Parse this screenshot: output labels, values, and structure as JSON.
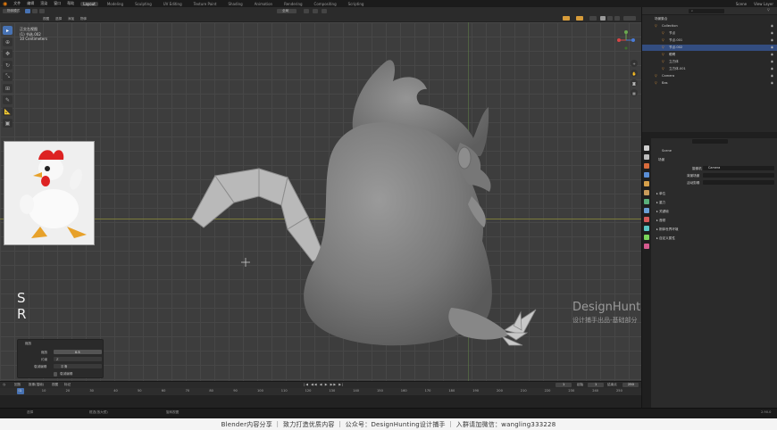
{
  "topbar": {
    "menus": [
      "文件",
      "编辑",
      "渲染",
      "窗口",
      "帮助"
    ],
    "workspaces": [
      "Layout",
      "Modeling",
      "Sculpting",
      "UV Editing",
      "Texture Paint",
      "Shading",
      "Animation",
      "Rendering",
      "Compositing",
      "Scripting"
    ],
    "active_workspace": "Layout",
    "scene": "Scene",
    "view_layer": "View Layer"
  },
  "viewport_header": {
    "mode": "物体模式",
    "menus": [
      "视图",
      "选择",
      "添加",
      "物体"
    ],
    "orientation": "全局"
  },
  "viewport_info": {
    "line1": "正交左视图",
    "line2": "(1) 节选.002",
    "line3": "10 Centimeters"
  },
  "overlay": {
    "sr_line1": "S",
    "sr_line2": "R"
  },
  "watermark": {
    "title": "DesignHunting",
    "subtitle": "设计捕手出品-基础部分"
  },
  "operator_panel": {
    "title": "缩放",
    "row1_label": "缩放",
    "row1_value": "0.5",
    "row2_label": "约束",
    "row2_value": "Z",
    "row3_label": "衰减编辑",
    "row3_value": "平滑",
    "checkbox_label": "衰减编辑"
  },
  "outliner": {
    "root": "场景集合",
    "items": [
      {
        "name": "Collection",
        "indent": 1,
        "selected": false
      },
      {
        "name": "节点",
        "indent": 2,
        "selected": false
      },
      {
        "name": "节点.001",
        "indent": 2,
        "selected": false
      },
      {
        "name": "节点.002",
        "indent": 2,
        "selected": true
      },
      {
        "name": "眼睛",
        "indent": 2,
        "selected": false
      },
      {
        "name": "立方体",
        "indent": 2,
        "selected": false
      },
      {
        "name": "立方体.001",
        "indent": 2,
        "selected": false
      },
      {
        "name": "Camera",
        "indent": 1,
        "selected": false
      },
      {
        "name": "Bas",
        "indent": 1,
        "selected": false
      }
    ]
  },
  "properties": {
    "tab_colors": [
      "#cfcfcf",
      "#bdbdbd",
      "#d96b3c",
      "#5a8ed6",
      "#d6a04a",
      "#c99b5a",
      "#5ab07a",
      "#6a9fd6",
      "#d65a5a",
      "#5ac5c5",
      "#7ad65a",
      "#d65a8e"
    ],
    "scene_name": "Scene",
    "section_scene": "场景",
    "camera_label": "摄像机",
    "camera_value": "Camera",
    "bg_scene_label": "背景场景",
    "active_clip_label": "活动剪辑",
    "sections": [
      "单位",
      "重力",
      "关键帧",
      "音频",
      "刚体世界环境",
      "自定义属性"
    ]
  },
  "timeline": {
    "menus": [
      "回放",
      "抠像(插帧)",
      "视图",
      "标记"
    ],
    "current_frame": "1",
    "start_label": "起始",
    "start": "1",
    "end_label": "结束点",
    "end": "250",
    "ticks": [
      "0",
      "10",
      "20",
      "30",
      "40",
      "50",
      "60",
      "70",
      "80",
      "90",
      "100",
      "110",
      "120",
      "130",
      "140",
      "150",
      "160",
      "170",
      "180",
      "190",
      "200",
      "210",
      "220",
      "230",
      "240",
      "250"
    ]
  },
  "statusbar": {
    "item1": "选择",
    "item2": "框选(放大镜)",
    "item3": "旋转视图",
    "version": "2.90.0"
  },
  "caption": "Blender内容分享  ｜  致力打造优质内容  ｜  公众号：DesignHunting设计捕手  ｜  入群请加微信：wangling333228"
}
